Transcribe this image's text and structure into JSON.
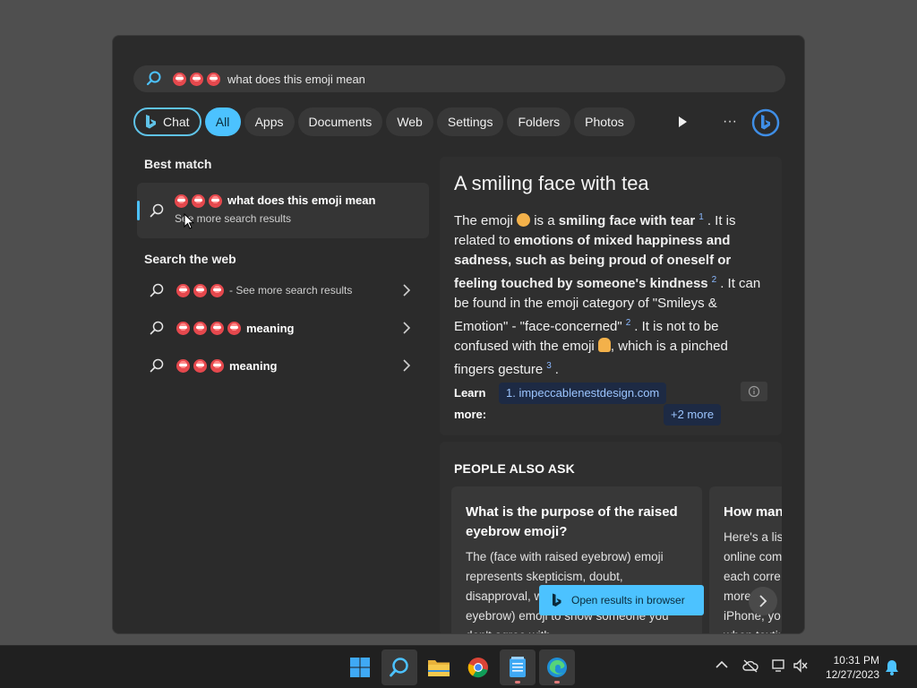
{
  "search": {
    "query": "what does this emoji mean",
    "emoji_count": 3
  },
  "filters": {
    "chat_label": "Chat",
    "items": [
      "All",
      "Apps",
      "Documents",
      "Web",
      "Settings",
      "Folders",
      "Photos"
    ],
    "active": "All",
    "more_label": "···"
  },
  "left": {
    "best_match_title": "Best match",
    "best_match": {
      "title": "what does this emoji mean",
      "subtitle": "See more search results"
    },
    "search_web_title": "Search the web",
    "web_rows": [
      {
        "text": "- See more search results"
      },
      {
        "text": "meaning"
      },
      {
        "text": "meaning"
      }
    ]
  },
  "answer": {
    "title": "A smiling face with tea",
    "p_text_1": "The emoji ",
    "p_text_2": " is a ",
    "p_bold_1": "smiling face with tear",
    "sup_1": "1",
    "p_text_3": ". It is related to ",
    "p_bold_2": "emotions of mixed happiness and sadness, such as being proud of oneself or feeling touched by someone's kindness",
    "sup_2": "2",
    "p_text_4": ". It can be found in the emoji category of \"Smileys & Emotion\" - \"face-concerned\"",
    "sup_3": "2",
    "p_text_5": ". It is not to be confused with the emoji ",
    "p_text_6": ", which is a pinched fingers gesture",
    "sup_4": "3",
    "p_text_7": ".",
    "learn_more": "Learn more:",
    "source_1": "1. impeccablenestdesign.com",
    "more_sources": "+2 more"
  },
  "people_also_ask": {
    "title": "PEOPLE ALSO ASK",
    "cards": [
      {
        "question": "What is the purpose of the raised eyebrow emoji?",
        "answer": "The (face with raised eyebrow) emoji represents skepticism, doubt, disapproval, w... the (face with raised eyebrow) emoji to show someone you don't agree with"
      },
      {
        "question": "How man",
        "answer": "Here's a lis online com each corre more... iPhone, yo when textir"
      }
    ],
    "open_button": "Open results in browser"
  },
  "taskbar": {
    "time": "10:31 PM",
    "date": "12/27/2023"
  },
  "colors": {
    "accent": "#4cc2ff",
    "panel": "#2b2b2b",
    "desktop": "#4f4f4f"
  }
}
